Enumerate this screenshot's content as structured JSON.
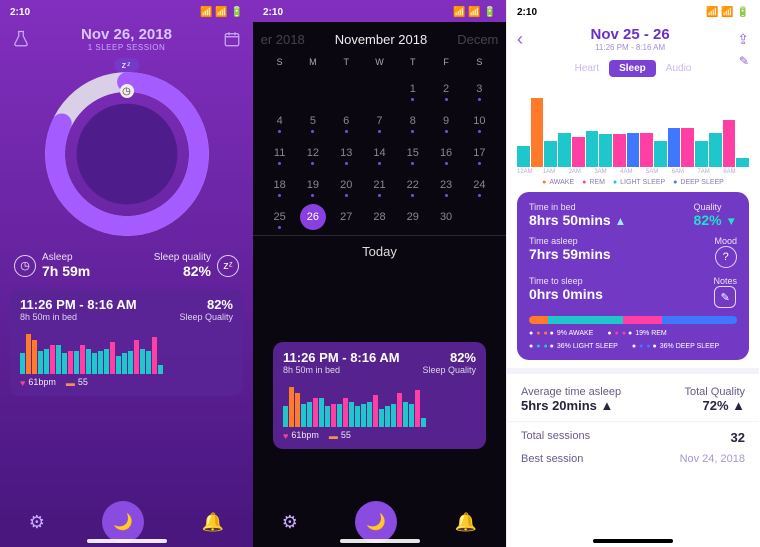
{
  "status": {
    "time": "2:10",
    "loc_arrow": "↗"
  },
  "s1": {
    "date": "Nov 26, 2018",
    "session_line": "1 SLEEP SESSION",
    "zz": "zᶻ",
    "asleep_label": "Asleep",
    "asleep_value": "7h 59m",
    "quality_label": "Sleep quality",
    "quality_value": "82%",
    "card": {
      "range": "11:26 PM - 8:16 AM",
      "in_bed": "8h 50m in bed",
      "pct": "82%",
      "sq": "Sleep Quality",
      "legend": {
        "hr": "61bpm",
        "db": "55"
      }
    }
  },
  "s2": {
    "prev": "er 2018",
    "month": "November 2018",
    "next": "Decem",
    "dow": [
      "S",
      "M",
      "T",
      "W",
      "T",
      "F",
      "S"
    ],
    "today": "Today",
    "selected": "26",
    "card": {
      "range": "11:26 PM - 8:16 AM",
      "in_bed": "8h 50m in bed",
      "pct": "82%",
      "sq": "Sleep Quality",
      "hr": "61bpm",
      "db": "55"
    }
  },
  "s3": {
    "date": "Nov 25 - 26",
    "sub": "11:26 PM - 8:16 AM",
    "tabs": {
      "heart": "Heart",
      "sleep": "Sleep",
      "audio": "Audio"
    },
    "xaxis": [
      "12AM",
      "1AM",
      "2AM",
      "3AM",
      "4AM",
      "5AM",
      "6AM",
      "7AM",
      "8AM"
    ],
    "legend": {
      "aw": "AWAKE",
      "rm": "REM",
      "ls": "LIGHT SLEEP",
      "ds": "DEEP SLEEP"
    },
    "stats": {
      "tib_l": "Time in bed",
      "tib_v": "8hrs 50mins",
      "q_l": "Quality",
      "q_v": "82%",
      "ta_l": "Time asleep",
      "ta_v": "7hrs 59mins",
      "mood_l": "Mood",
      "tts_l": "Time to sleep",
      "tts_v": "0hrs 0mins",
      "notes_l": "Notes"
    },
    "breakdown": {
      "aw": "9% AWAKE",
      "rm": "19% REM",
      "ls": "36% LIGHT SLEEP",
      "ds": "36% DEEP SLEEP"
    },
    "summary": {
      "avg_l": "Average time asleep",
      "avg_v": "5hrs 20mins",
      "tq_l": "Total Quality",
      "tq_v": "72%",
      "ts_l": "Total sessions",
      "ts_v": "32",
      "bs_l": "Best session",
      "bs_v": "Nov 24, 2018"
    }
  },
  "colors": {
    "awake": "#ff7a2b",
    "rem": "#ff3fa4",
    "light": "#1fc7cc",
    "deep": "#3f78ff",
    "ring": "#8a3fdf"
  },
  "chart_data": [
    {
      "type": "bar",
      "title": "Sleep session bars (screen 1 card)",
      "categories": [
        "c1",
        "c2",
        "c3",
        "c4",
        "c5",
        "c6",
        "c7",
        "c8",
        "c9",
        "c10",
        "c11",
        "c12",
        "c13",
        "c14",
        "c15",
        "c16",
        "c17",
        "c18",
        "c19",
        "c20",
        "c21",
        "c22",
        "c23",
        "c24"
      ],
      "series": [
        {
          "name": "awake",
          "values": [
            0,
            35,
            30,
            0,
            0,
            0,
            0,
            0,
            0,
            0,
            0,
            0,
            0,
            0,
            0,
            0,
            0,
            0,
            0,
            0,
            0,
            0,
            0,
            0
          ]
        },
        {
          "name": "rem",
          "values": [
            0,
            0,
            0,
            0,
            0,
            25,
            0,
            0,
            20,
            0,
            25,
            0,
            0,
            0,
            0,
            28,
            0,
            0,
            0,
            30,
            0,
            0,
            32,
            0
          ]
        },
        {
          "name": "light",
          "values": [
            18,
            0,
            0,
            20,
            22,
            0,
            25,
            18,
            0,
            20,
            0,
            22,
            18,
            20,
            22,
            0,
            16,
            18,
            20,
            0,
            22,
            20,
            0,
            8
          ]
        },
        {
          "name": "deep",
          "values": [
            0,
            0,
            0,
            0,
            0,
            0,
            0,
            0,
            0,
            0,
            0,
            0,
            0,
            0,
            0,
            0,
            10,
            0,
            0,
            0,
            0,
            0,
            0,
            0
          ]
        }
      ],
      "ylim": [
        0,
        40
      ]
    },
    {
      "type": "pie",
      "title": "Sleep ring (screen 1)",
      "categories": [
        "asleep",
        "gap"
      ],
      "values": [
        82,
        18
      ]
    },
    {
      "type": "bar",
      "title": "Sleep stage bars (screen 3)",
      "categories": [
        "12AM",
        "",
        "1AM",
        "",
        "2AM",
        "",
        "3AM",
        "",
        "4AM",
        "",
        "5AM",
        "",
        "6AM",
        "",
        "7AM",
        "",
        "8AM"
      ],
      "series": [
        {
          "name": "awake",
          "values": [
            0,
            80,
            0,
            0,
            0,
            0,
            0,
            0,
            0,
            0,
            0,
            0,
            0,
            0,
            0,
            0,
            0
          ]
        },
        {
          "name": "rem",
          "values": [
            0,
            0,
            0,
            0,
            35,
            0,
            0,
            38,
            0,
            40,
            0,
            0,
            45,
            0,
            0,
            55,
            0
          ]
        },
        {
          "name": "light",
          "values": [
            25,
            0,
            30,
            40,
            0,
            42,
            38,
            0,
            28,
            0,
            30,
            25,
            0,
            30,
            40,
            0,
            10
          ]
        },
        {
          "name": "deep",
          "values": [
            0,
            0,
            0,
            0,
            0,
            0,
            0,
            0,
            40,
            0,
            0,
            45,
            0,
            0,
            0,
            0,
            0
          ]
        }
      ],
      "ylim": [
        0,
        100
      ]
    },
    {
      "type": "bar",
      "title": "Sleep breakdown segment bar",
      "categories": [
        "awake",
        "light",
        "rem",
        "deep"
      ],
      "values": [
        9,
        36,
        19,
        36
      ]
    }
  ]
}
